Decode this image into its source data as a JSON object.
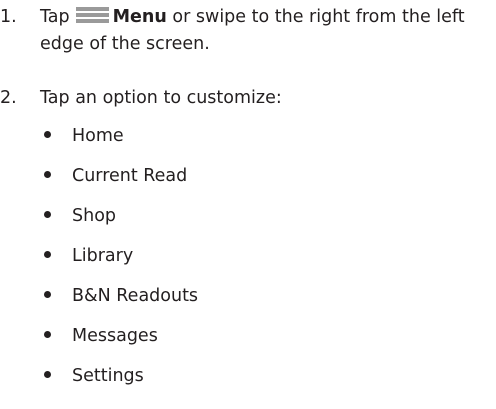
{
  "steps": [
    {
      "number": "1.",
      "line1_prefix": "Tap",
      "line1_bold": "Menu",
      "line1_suffix": "or swipe to the right from the left",
      "line2": "edge of the screen.",
      "icon": "menu-icon"
    },
    {
      "number": "2.",
      "text": "Tap an option to customize:"
    }
  ],
  "options": [
    "Home",
    "Current Read",
    "Shop",
    "Library",
    "B&N Readouts",
    "Messages",
    "Settings"
  ],
  "colors": {
    "text": "#231f20",
    "icon": "#9a9a9a"
  }
}
